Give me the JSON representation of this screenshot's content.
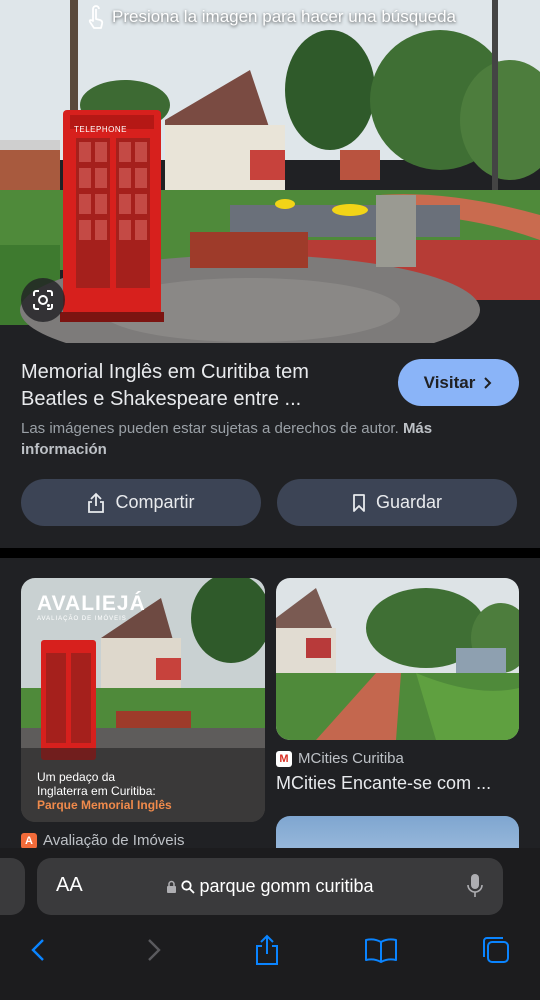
{
  "hero": {
    "hint_text": "Presiona la imagen para hacer una búsqueda",
    "sign_text": "TELEPHONE"
  },
  "result": {
    "title": "Memorial Inglês em Curitiba tem Beatles e Shakespeare entre ...",
    "visit_label": "Visitar",
    "copyright_text": "Las imágenes pueden estar sujetas a derechos de autor.",
    "more_info_label": "Más información",
    "share_label": "Compartir",
    "save_label": "Guardar"
  },
  "related": [
    {
      "brand": "AVALIEJÁ",
      "brand_sub": "AVALIAÇÃO DE IMÓVEIS",
      "overlay_line1": "Um pedaço da",
      "overlay_line2": "Inglaterra em Curitiba:",
      "overlay_highlight": "Parque Memorial Inglês",
      "source": "Avaliação de Imóveis",
      "favicon": "A"
    },
    {
      "source": "MCities Curitiba",
      "title": "MCities Encante-se com ...",
      "favicon": "M"
    }
  ],
  "browser": {
    "aa_label": "AA",
    "url": "parque gomm curitiba"
  },
  "colors": {
    "accent": "#8ab4f8",
    "button_bg": "#3c4455",
    "panel_bg": "#202124"
  },
  "icons": [
    "touch-icon",
    "lens-icon",
    "chevron-right-icon",
    "share-icon",
    "bookmark-icon",
    "lock-icon",
    "search-icon",
    "mic-icon",
    "back-icon",
    "forward-icon",
    "safari-share-icon",
    "bookmarks-icon",
    "tabs-icon"
  ]
}
